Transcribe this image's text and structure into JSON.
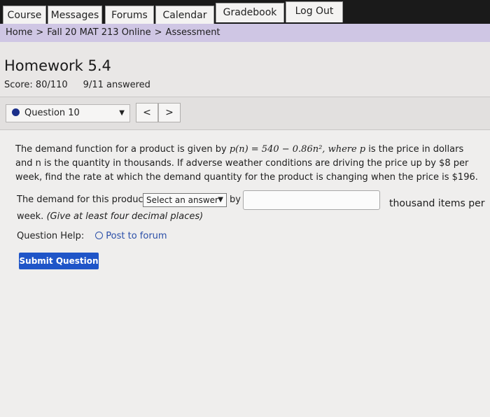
{
  "nav": {
    "tabs": [
      "Course",
      "Messages",
      "Forums",
      "Calendar",
      "Gradebook",
      "Log Out"
    ]
  },
  "breadcrumb": {
    "home": "Home",
    "course": "Fall 20 MAT 213 Online",
    "page": "Assessment",
    "separator": ">"
  },
  "assignment": {
    "title": "Homework 5.4",
    "score": "Score: 80/110",
    "answered": "9/11 answered"
  },
  "question_nav": {
    "selected": "Question 10",
    "prev": "<",
    "next": ">"
  },
  "problem": {
    "intro": "The demand function for a product is given by ",
    "formula": "p(n) = 540 − 0.86n², where p",
    "text_rest": " is the price in dollars and n is the quantity in thousands. If adverse weather conditions are driving the price up by $8 per week, find the rate at which the demand quantity for the product is changing when the price is $196."
  },
  "answer": {
    "prefix": "The demand for this product is",
    "dropdown": "Select an answer",
    "by": "by",
    "input_value": "",
    "units": "thousand items per",
    "week": "week.",
    "hint": "(Give at least four decimal places)"
  },
  "help": {
    "label": "Question Help:",
    "link": "Post to forum"
  },
  "submit_label": "Submit Question",
  "colors": {
    "topbar": "#1a1a1a",
    "breadcrumb_bg": "#cfc6e4",
    "submit": "#1f55c8",
    "link": "#2b4fa8"
  }
}
